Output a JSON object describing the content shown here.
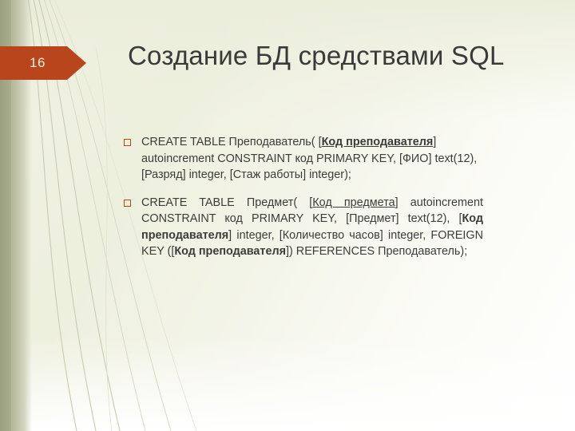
{
  "slide": {
    "number": "16",
    "title": "Создание БД средствами SQL",
    "accent_color": "#b9451d",
    "text_color": "#3c3c3a",
    "background_colors": [
      "#f1f2e2",
      "#ffffff",
      "#a7ab8c"
    ]
  },
  "bullets": [
    {
      "marker": "square-bullet",
      "alignment": "left",
      "segments": [
        {
          "text": "CREATE TABLE Преподаватель( [",
          "style": "plain"
        },
        {
          "text": "Код преподавателя",
          "style": "bold-underline"
        },
        {
          "text": "] autoincrement CONSTRAINT код PRIMARY KEY, [ФИО] text(12), [Разряд] integer, [Стаж работы] integer);",
          "style": "plain"
        }
      ],
      "plain_text": "CREATE TABLE Преподаватель( [Код преподавателя] autoincrement CONSTRAINT код PRIMARY KEY, [ФИО] text(12), [Разряд] integer, [Стаж работы] integer);"
    },
    {
      "marker": "square-bullet",
      "alignment": "justify",
      "segments": [
        {
          "text": "CREATE TABLE Предмет( [",
          "style": "plain"
        },
        {
          "text": "Код предмета",
          "style": "underline"
        },
        {
          "text": "] autoincrement CONSTRAINT код PRIMARY KEY, [Предмет] text(12), [",
          "style": "plain"
        },
        {
          "text": "Код преподавателя",
          "style": "bold"
        },
        {
          "text": "] integer, [Количество часов] integer, FOREIGN KEY ([",
          "style": "plain"
        },
        {
          "text": "Код преподавателя",
          "style": "bold"
        },
        {
          "text": "]) REFERENCES Преподаватель);",
          "style": "plain"
        }
      ],
      "plain_text": "CREATE TABLE Предмет( [Код предмета] autoincrement CONSTRAINT код PRIMARY KEY, [Предмет] text(12), [Код преподавателя] integer, [Количество часов] integer, FOREIGN KEY ([Код преподавателя]) REFERENCES Преподаватель);"
    }
  ]
}
